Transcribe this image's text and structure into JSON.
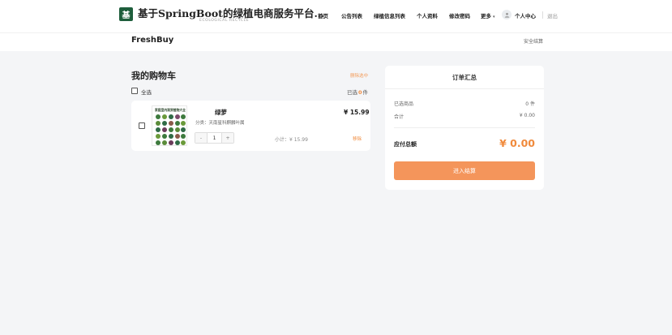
{
  "header": {
    "logo_char": "基",
    "site_title": "基于SpringBoot的绿植电商服务平台…",
    "site_subtitle": "ECOLOGICAL RECYCLE",
    "nav": [
      "首页",
      "公告列表",
      "绿植信息列表",
      "个人资料",
      "修改密码"
    ],
    "more_label": "更多",
    "user_center_label": "个人中心",
    "logout_label": "退出"
  },
  "subheader": {
    "brand": "FreshBuy",
    "secure_label": "安全结算"
  },
  "cart": {
    "title": "我的购物车",
    "remove_selected_label": "删除选中",
    "select_all_label": "全选",
    "selected_prefix": "已选",
    "selected_count": "0",
    "selected_suffix": "件",
    "items": [
      {
        "thumb_title": "家庭室内观赏植物大全",
        "name": "绿萝",
        "category": "分类：天南星科麒麟叶属",
        "price": "¥ 15.99",
        "quantity": "1",
        "minus_label": "-",
        "plus_label": "+",
        "subtotal": "小计：¥ 15.99",
        "remove_label": "移除"
      }
    ]
  },
  "summary": {
    "title": "订单汇总",
    "selected_goods_label": "已选商品",
    "selected_goods_value": "0 件",
    "total_label": "合计",
    "total_value": "¥ 0.00",
    "payable_label": "应付总额",
    "payable_value": "¥ 0.00",
    "checkout_label": "进入结算"
  },
  "colors": {
    "accent": "#f08a3c",
    "button": "#f4955b",
    "logo_bg": "#1e5e3c",
    "page_bg": "#f4f5f7"
  },
  "icons": {
    "more": "chevron-down-icon",
    "user": "user-icon"
  }
}
